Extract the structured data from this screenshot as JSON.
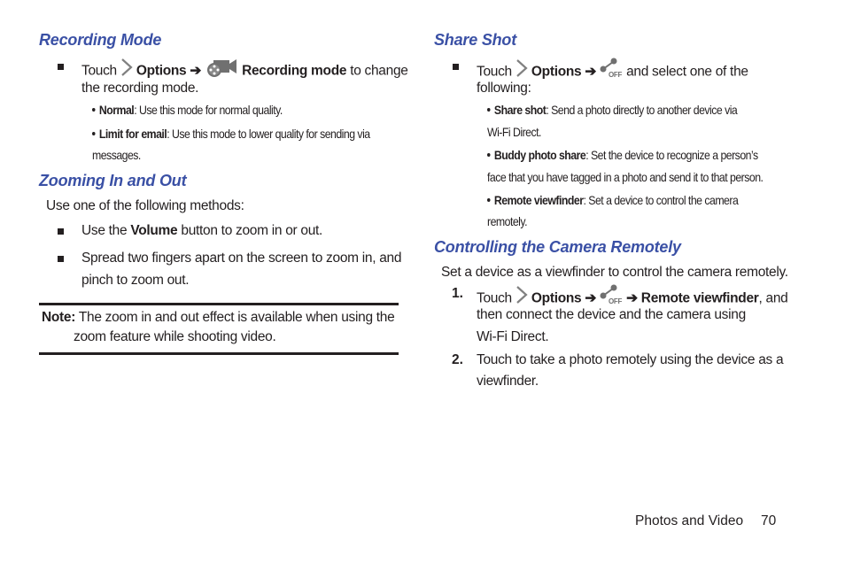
{
  "left": {
    "recording_mode": {
      "heading": "Recording Mode",
      "step": {
        "touch": "Touch",
        "options": "Options",
        "arrow": "➔",
        "target": "Recording mode",
        "rest_line1": " to change",
        "line2": "the recording mode."
      },
      "sub_items": [
        {
          "term": "Normal",
          "desc": ": Use this mode for normal quality."
        },
        {
          "term": "Limit for email",
          "desc": ": Use this mode to lower quality for sending via",
          "desc_line2": "messages."
        }
      ]
    },
    "zooming": {
      "heading": "Zooming In and Out",
      "intro": "Use one of the following methods:",
      "items": [
        {
          "pre": "Use the ",
          "bold": "Volume",
          "post": " button to zoom in or out."
        },
        {
          "line1": "Spread two fingers apart on the screen to zoom in, and",
          "line2": "pinch to zoom out."
        }
      ]
    },
    "note": {
      "label": "Note:",
      "line1": " The zoom in and out effect is available when using the",
      "line2": "zoom feature while shooting video."
    }
  },
  "right": {
    "share_shot": {
      "heading": "Share Shot",
      "step": {
        "touch": "Touch",
        "options": "Options",
        "arrow": "➔",
        "rest_line1": " and select one of the",
        "line2": "following:"
      },
      "sub_items": [
        {
          "term": "Share shot",
          "desc": ": Send a photo directly to another device via",
          "desc_line2": "Wi-Fi Direct."
        },
        {
          "term": "Buddy photo share",
          "desc": ": Set the device to recognize a person’s",
          "desc_line2": "face that you have tagged in a photo and send it to that person."
        },
        {
          "term": "Remote viewfinder",
          "desc": ": Set a device to control the camera",
          "desc_line2": "remotely."
        }
      ]
    },
    "remote": {
      "heading": "Controlling the Camera Remotely",
      "intro": "Set a device as a viewfinder to control the camera remotely.",
      "steps": [
        {
          "num": "1.",
          "touch": "Touch",
          "options": "Options",
          "arrow": "➔",
          "arrow2": "➔",
          "target": "Remote viewfinder",
          "rest_line1": ", and",
          "line2": "then connect the device and the camera using",
          "line3": "Wi-Fi Direct."
        },
        {
          "num": "2.",
          "line1": "Touch to take a photo remotely using the device as a",
          "line2": "viewfinder."
        }
      ]
    }
  },
  "icons": {
    "chevron": "chevron-right-icon",
    "recording_mode": "video-camera-reel-icon",
    "share_shot": "share-off-icon",
    "off_label": "OFF"
  },
  "footer": {
    "section": "Photos and Video",
    "page": "70"
  },
  "colors": {
    "heading": "#3a50a5",
    "text": "#231f20",
    "icon_gray": "#808080"
  }
}
